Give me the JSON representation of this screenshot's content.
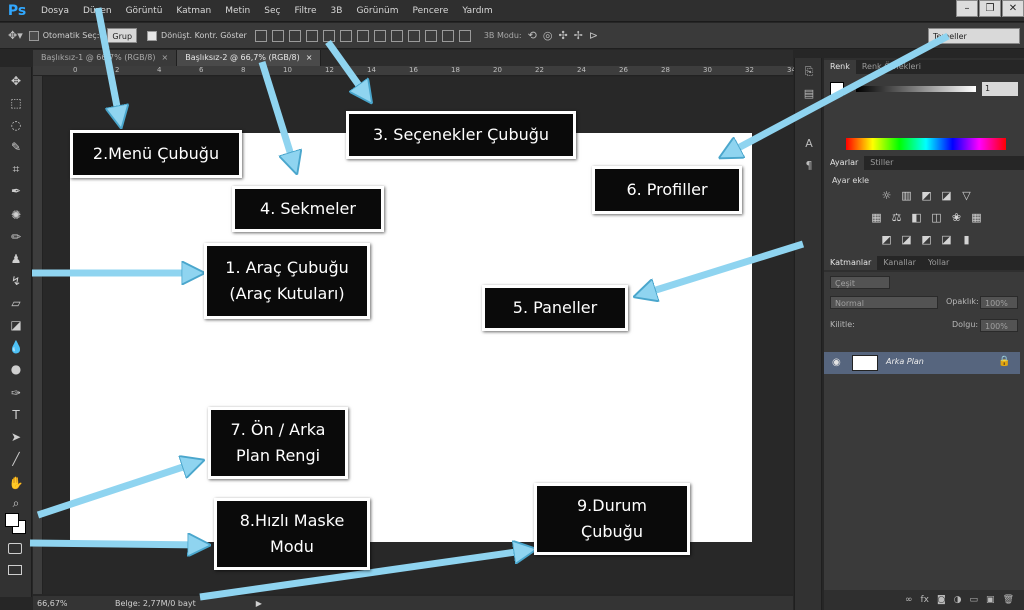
{
  "app": {
    "logo": "Ps",
    "menu": [
      "Dosya",
      "Düzen",
      "Görüntü",
      "Katman",
      "Metin",
      "Seç",
      "Filtre",
      "3B",
      "Görünüm",
      "Pencere",
      "Yardım"
    ],
    "window_controls": [
      "–",
      "❐",
      "✕"
    ]
  },
  "options_bar": {
    "auto_select_label": "Otomatik Seç:",
    "group_select": "Grup",
    "show_transform_label": "Dönüşt. Kontr. Göster",
    "mode3d_label": "3B Modu:",
    "workspace": "Temeller"
  },
  "tabs": [
    {
      "label": "Başlıksız-1 @ 66,7% (RGB/8)",
      "close": "×",
      "active": false
    },
    {
      "label": "Başlıksız-2 @ 66,7% (RGB/8)",
      "close": "×",
      "active": true
    }
  ],
  "ruler": {
    "top_numbers": [
      "0",
      "2",
      "4",
      "6",
      "8",
      "10",
      "12",
      "14",
      "16",
      "18",
      "20",
      "22",
      "24",
      "26",
      "28",
      "30",
      "32",
      "34"
    ]
  },
  "status_bar": {
    "zoom": "66,67%",
    "doc_info": "Belge: 2,77M/0 bayt",
    "arrow": "▶"
  },
  "panels": {
    "color": {
      "tabs": [
        "Renk",
        "Renk Örnekleri"
      ],
      "value": "1"
    },
    "adjustments": {
      "tabs": [
        "Ayarlar",
        "Stiller"
      ],
      "title": "Ayar ekle"
    },
    "layers": {
      "tabs": [
        "Katmanlar",
        "Kanallar",
        "Yollar"
      ],
      "kind_filter": "Çeşit",
      "blend_mode": "Normal",
      "opacity_label": "Opaklık:",
      "opacity_value": "100%",
      "lock_label": "Kilitle:",
      "fill_label": "Dolgu:",
      "fill_value": "100%",
      "layer_name": "Arka Plan"
    }
  },
  "annotations": {
    "menu_bar": "2.Menü Çubuğu",
    "options_bar": "3. Seçenekler Çubuğu",
    "tabs": "4. Sekmeler",
    "tools_bar": "1. Araç Çubuğu\n(Araç Kutuları)",
    "profiles": "6. Profiller",
    "panels": "5. Paneller",
    "fg_bg_color": "7. Ön / Arka\nPlan Rengi",
    "quick_mask": "8.Hızlı Maske\nModu",
    "status_bar": "9.Durum\nÇubuğu"
  },
  "colors": {
    "arrow_fill": "#8fd4f0",
    "arrow_stroke": "#4aa6cc",
    "callout_bg": "#0a0a0a",
    "layer_selected": "#56657e",
    "ps_logo": "#31a8ff"
  }
}
